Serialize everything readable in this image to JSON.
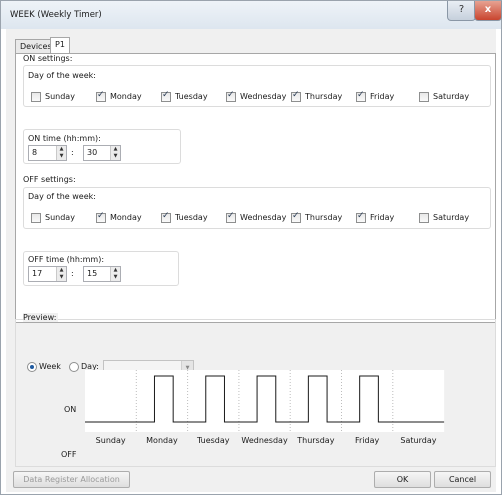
{
  "window": {
    "title": "WEEK (Weekly Timer)",
    "help_glyph": "?",
    "close_glyph": "x"
  },
  "tabs": [
    {
      "label": "Devices"
    },
    {
      "label": "P1"
    }
  ],
  "on_settings": {
    "heading": "ON settings:",
    "day_heading": "Day of the week:",
    "days": [
      {
        "label": "Sunday",
        "checked": false
      },
      {
        "label": "Monday",
        "checked": true
      },
      {
        "label": "Tuesday",
        "checked": true
      },
      {
        "label": "Wednesday",
        "checked": true
      },
      {
        "label": "Thursday",
        "checked": true
      },
      {
        "label": "Friday",
        "checked": true
      },
      {
        "label": "Saturday",
        "checked": false
      }
    ],
    "time_label": "ON time (hh:mm):",
    "hour": "8",
    "separator": ":",
    "minute": "30"
  },
  "off_settings": {
    "heading": "OFF settings:",
    "day_heading": "Day of the week:",
    "days": [
      {
        "label": "Sunday",
        "checked": false
      },
      {
        "label": "Monday",
        "checked": true
      },
      {
        "label": "Tuesday",
        "checked": true
      },
      {
        "label": "Wednesday",
        "checked": true
      },
      {
        "label": "Thursday",
        "checked": true
      },
      {
        "label": "Friday",
        "checked": true
      },
      {
        "label": "Saturday",
        "checked": false
      }
    ],
    "time_label": "OFF time (hh:mm):",
    "hour": "17",
    "separator": ":",
    "minute": "15"
  },
  "preview": {
    "heading": "Preview:",
    "week_label": "Week",
    "day_label": "Day:",
    "selected_mode": "Week",
    "day_value": "",
    "on_label": "ON",
    "off_label": "OFF",
    "colors": {
      "signal": "#1a1a1a",
      "divider": "#bdbdbd"
    }
  },
  "chart_data": {
    "type": "line",
    "categories": [
      "Sunday",
      "Monday",
      "Tuesday",
      "Wednesday",
      "Thursday",
      "Friday",
      "Saturday"
    ],
    "levels": [
      "OFF",
      "ON"
    ],
    "series": [
      {
        "values": [
          0,
          1,
          1,
          1,
          1,
          1,
          0
        ],
        "on_time": "8:30",
        "off_time": "17:15"
      }
    ]
  },
  "footer": {
    "data_register_label": "Data Register Allocation",
    "ok_label": "OK",
    "cancel_label": "Cancel"
  }
}
